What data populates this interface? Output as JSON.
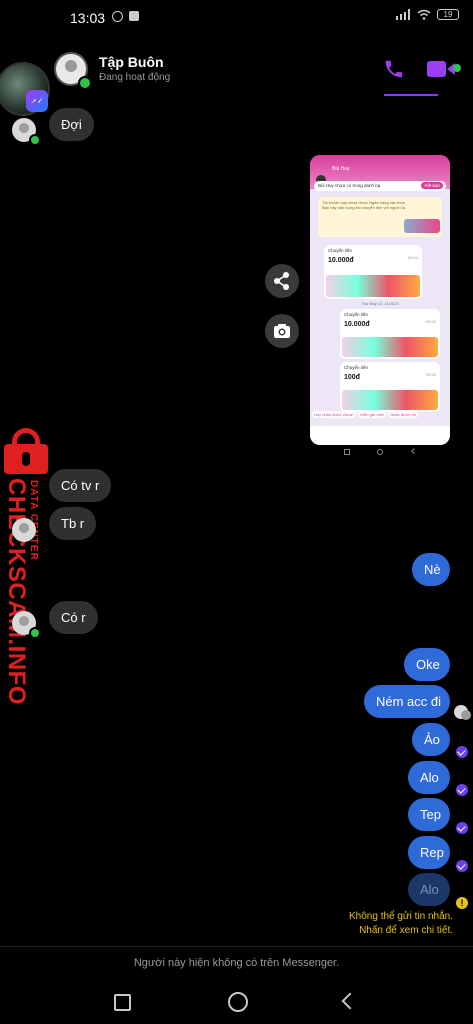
{
  "status_bar": {
    "time": "13:03",
    "battery": "19"
  },
  "header": {
    "name": "Tập Buôn",
    "status": "Đang hoạt động",
    "call_icon": "phone-icon",
    "video_icon": "video-camera-icon",
    "accent": "#9b3ff5"
  },
  "messages_in": [
    {
      "text": "Đợi"
    },
    {
      "text": "Có tv r"
    },
    {
      "text": "Tb r"
    },
    {
      "text": "Có r"
    }
  ],
  "messages_out": [
    {
      "text": "Nè"
    },
    {
      "text": "Oke"
    },
    {
      "text": "Ném acc đi"
    },
    {
      "text": "Ảo"
    },
    {
      "text": "Alo"
    },
    {
      "text": "Tep"
    },
    {
      "text": "Rep"
    },
    {
      "text": "Alo"
    }
  ],
  "error": {
    "line1": "Không thể gửi tin nhắn.",
    "line2": "Nhấn để xem chi tiết."
  },
  "screenshot": {
    "name": "Bùi Huy",
    "banner_btn": "Kết bạn",
    "banner_text": "Bùi Huy chưa có trong danh bạ",
    "warning": "Tài khoản này chưa được Ngân hàng xác thực. Bạn hãy cẩn trọng khi chuyển tiền với người lạ.",
    "transfers": [
      {
        "label": "Chuyển tiền",
        "amount": "10.000đ",
        "time": "09:44"
      },
      {
        "label": "Chuyển tiền",
        "amount": "10.000đ",
        "time": "09:52"
      },
      {
        "label": "Chuyển tiền",
        "amount": "100đ",
        "time": "09:52"
      }
    ],
    "date_sep": "Thứ Bảy 13, 11/2023",
    "suggestions": [
      "Huy nhận được chưa?",
      "Hiểu giờ nhé!",
      "Nhắn được rồi"
    ]
  },
  "watermark": {
    "main": "CHECKSCAM.INFO",
    "sub": "DATA CENTER"
  },
  "footer": {
    "text": "Người này hiện không có trên Messenger."
  }
}
